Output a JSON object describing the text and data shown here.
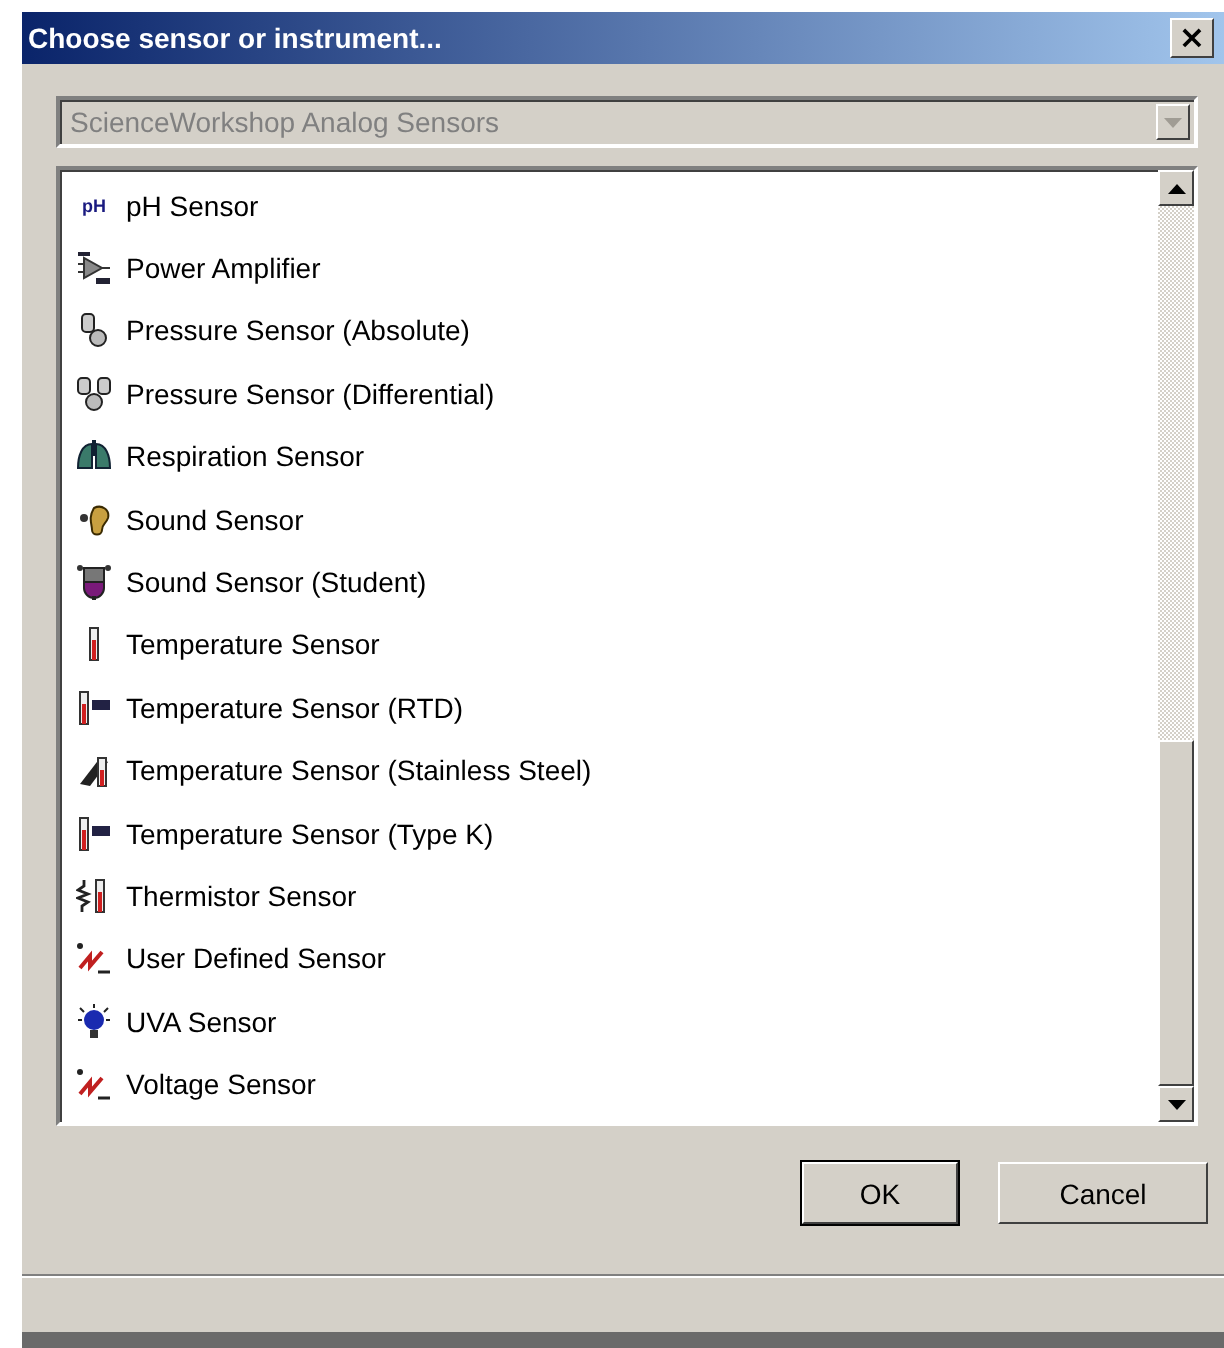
{
  "window": {
    "title": "Choose sensor or instrument...",
    "close": "×"
  },
  "category_dropdown": {
    "value": "ScienceWorkshop Analog Sensors",
    "disabled": true
  },
  "sensors": [
    {
      "name": "pH Sensor",
      "badge": "pH"
    },
    {
      "name": "Power Amplifier"
    },
    {
      "name": "Pressure Sensor (Absolute)"
    },
    {
      "name": "Pressure Sensor (Differential)"
    },
    {
      "name": "Respiration Sensor"
    },
    {
      "name": "Sound Sensor"
    },
    {
      "name": "Sound Sensor (Student)"
    },
    {
      "name": "Temperature Sensor"
    },
    {
      "name": "Temperature Sensor (RTD)"
    },
    {
      "name": "Temperature Sensor (Stainless Steel)"
    },
    {
      "name": "Temperature Sensor (Type K)"
    },
    {
      "name": "Thermistor Sensor"
    },
    {
      "name": "User Defined Sensor"
    },
    {
      "name": "UVA Sensor"
    },
    {
      "name": "Voltage Sensor"
    }
  ],
  "buttons": [
    {
      "label": "OK",
      "default": true
    },
    {
      "label": "Cancel",
      "default": false
    }
  ]
}
